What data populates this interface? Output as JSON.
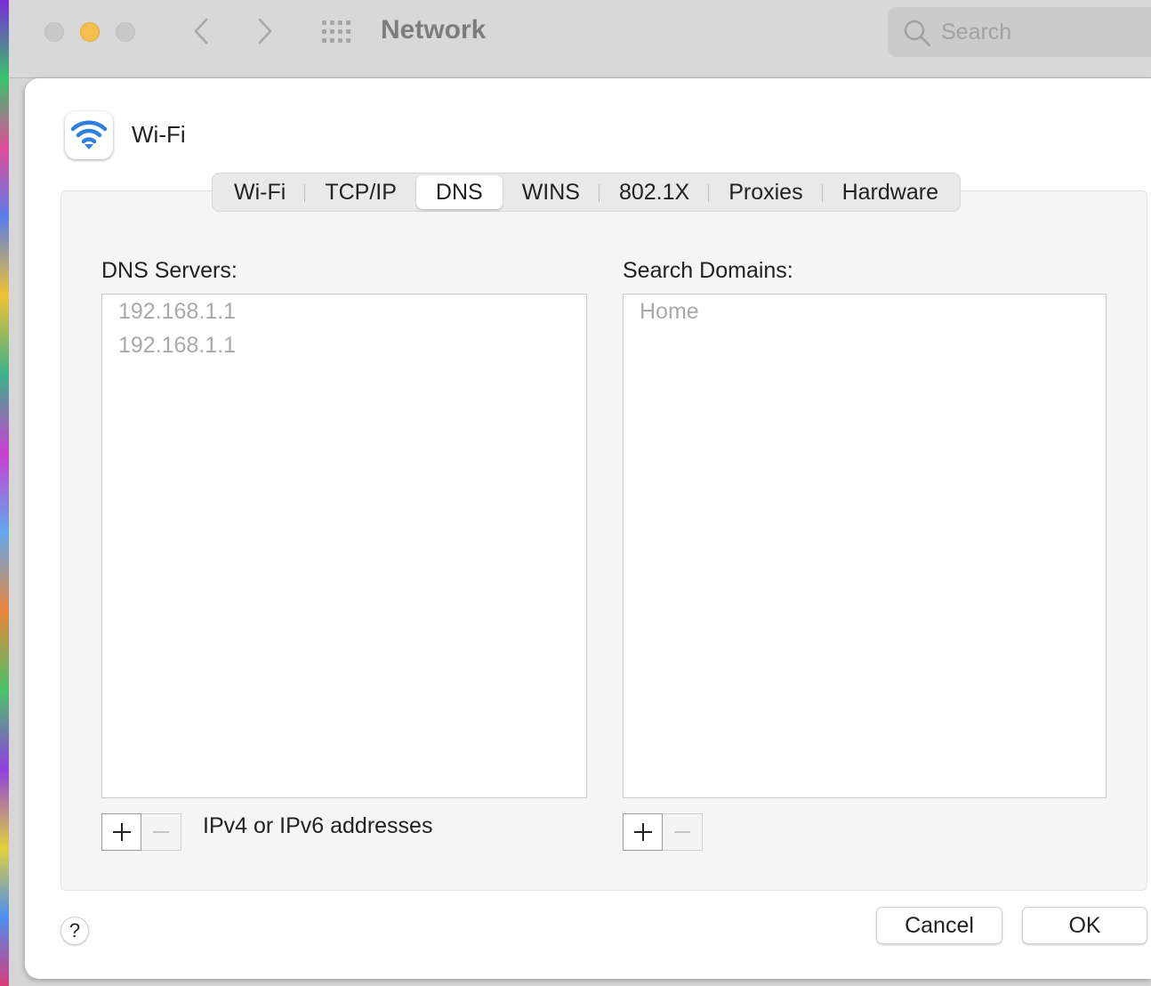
{
  "window": {
    "title": "Network",
    "search_placeholder": "Search"
  },
  "icons": {
    "back": "chevron-left-icon",
    "forward": "chevron-right-icon",
    "show_all": "grid-icon",
    "search": "search-icon",
    "interface": "wifi-icon",
    "help": "question-icon"
  },
  "colors": {
    "accent_blue": "#2f7fe0",
    "minimize_yellow": "#f6be4f"
  },
  "sheet": {
    "interface_name": "Wi-Fi",
    "tabs": [
      {
        "label": "Wi-Fi",
        "active": false
      },
      {
        "label": "TCP/IP",
        "active": false
      },
      {
        "label": "DNS",
        "active": true
      },
      {
        "label": "WINS",
        "active": false
      },
      {
        "label": "802.1X",
        "active": false
      },
      {
        "label": "Proxies",
        "active": false
      },
      {
        "label": "Hardware",
        "active": false
      }
    ],
    "dns_servers": {
      "label": "DNS Servers:",
      "items": [
        "192.168.1.1",
        "192.168.1.1"
      ],
      "hint": "IPv4 or IPv6 addresses"
    },
    "search_domains": {
      "label": "Search Domains:",
      "items": [
        "Home"
      ]
    },
    "help_label": "?",
    "cancel_label": "Cancel",
    "ok_label": "OK"
  }
}
